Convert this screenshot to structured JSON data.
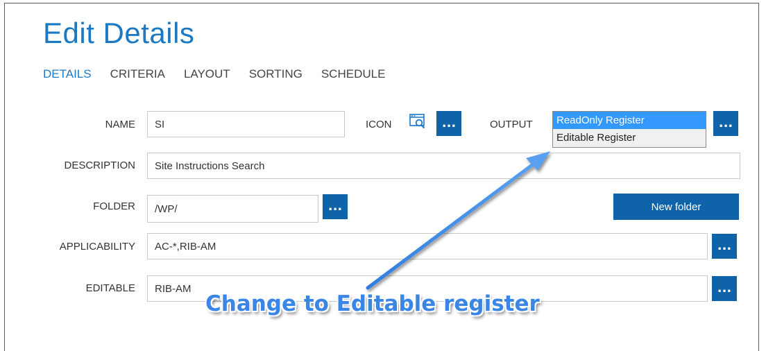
{
  "page": {
    "title": "Edit Details"
  },
  "tabs": [
    {
      "label": "DETAILS",
      "active": true
    },
    {
      "label": "CRITERIA",
      "active": false
    },
    {
      "label": "LAYOUT",
      "active": false
    },
    {
      "label": "SORTING",
      "active": false
    },
    {
      "label": "SCHEDULE",
      "active": false
    }
  ],
  "form": {
    "name": {
      "label": "NAME",
      "value": "SI"
    },
    "icon": {
      "label": "ICON",
      "icon_name": "search-window-icon",
      "browse_label": "..."
    },
    "output": {
      "label": "OUTPUT",
      "options": [
        "ReadOnly Register",
        "Editable Register"
      ],
      "selected": "ReadOnly Register",
      "browse_label": "..."
    },
    "description": {
      "label": "DESCRIPTION",
      "value": "Site Instructions Search"
    },
    "folder": {
      "label": "FOLDER",
      "value": "/WP/",
      "browse_label": "...",
      "new_folder_label": "New folder"
    },
    "applicability": {
      "label": "APPLICABILITY",
      "value": "AC-*,RIB-AM",
      "browse_label": "..."
    },
    "editable": {
      "label": "EDITABLE",
      "value": "RIB-AM",
      "browse_label": "..."
    }
  },
  "annotation": {
    "text": "Change to Editable register",
    "color": "#3a86e6"
  },
  "colors": {
    "accent": "#1b79c4",
    "button": "#0f63a8",
    "selection": "#3399ff"
  }
}
